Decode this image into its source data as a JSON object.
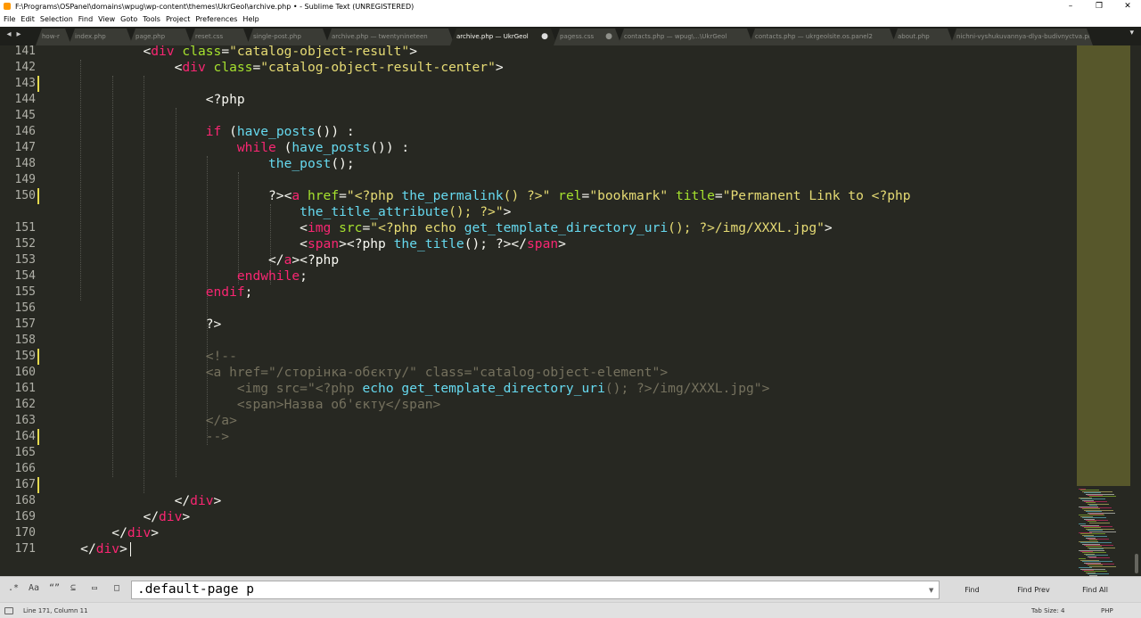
{
  "window": {
    "title": "F:\\Programs\\OSPanel\\domains\\wpug\\wp-content\\themes\\UkrGeol\\archive.php • - Sublime Text (UNREGISTERED)",
    "controls": [
      "–",
      "❐",
      "✕"
    ]
  },
  "menu": [
    "File",
    "Edit",
    "Selection",
    "Find",
    "View",
    "Goto",
    "Tools",
    "Project",
    "Preferences",
    "Help"
  ],
  "tabs": [
    {
      "label": "how-r",
      "active": false,
      "dirty": false
    },
    {
      "label": "index.php",
      "active": false,
      "dirty": false
    },
    {
      "label": "page.php",
      "active": false,
      "dirty": false
    },
    {
      "label": "reset.css",
      "active": false,
      "dirty": false
    },
    {
      "label": "single-post.php",
      "active": false,
      "dirty": false
    },
    {
      "label": "archive.php — twentynineteen",
      "active": false,
      "dirty": false
    },
    {
      "label": "archive.php — UkrGeol",
      "active": true,
      "dirty": true
    },
    {
      "label": "pagess.css",
      "active": false,
      "dirty": true
    },
    {
      "label": "contacts.php — wpug\\...\\UkrGeol",
      "active": false,
      "dirty": false
    },
    {
      "label": "contacts.php — ukrgeolsite.os.panel2",
      "active": false,
      "dirty": false
    },
    {
      "label": "about.php",
      "active": false,
      "dirty": false
    },
    {
      "label": "nichni-vyshukuvannya-dlya-budivnyctva.php",
      "active": false,
      "dirty": false
    }
  ],
  "tab_overflow": "▾",
  "gutter": {
    "line_numbers": [
      "141",
      "142",
      "143",
      "144",
      "145",
      "146",
      "147",
      "148",
      "149",
      "150",
      "",
      "151",
      "152",
      "153",
      "154",
      "155",
      "156",
      "157",
      "158",
      "159",
      "160",
      "161",
      "162",
      "163",
      "164",
      "165",
      "166",
      "167",
      "168",
      "169",
      "170",
      "171"
    ],
    "modified_lines": [
      "143",
      "150",
      "159",
      "164",
      "167"
    ]
  },
  "code_lines": [
    [
      [
        "            ",
        ""
      ],
      [
        "<",
        "t"
      ],
      [
        "div",
        "tag"
      ],
      [
        " class",
        "attr"
      ],
      [
        "=",
        ""
      ],
      [
        "\"catalog-object-result\"",
        "str"
      ],
      [
        ">",
        ""
      ]
    ],
    [
      [
        "                ",
        ""
      ],
      [
        "<",
        ""
      ],
      [
        "div",
        "tag"
      ],
      [
        " class",
        "attr"
      ],
      [
        "=",
        ""
      ],
      [
        "\"catalog-object-result-center\"",
        "str"
      ],
      [
        ">",
        ""
      ]
    ],
    [
      [
        "",
        ""
      ]
    ],
    [
      [
        "                    ",
        ""
      ],
      [
        "<?php",
        ""
      ]
    ],
    [
      [
        "",
        ""
      ]
    ],
    [
      [
        "                    ",
        ""
      ],
      [
        "if",
        "kw"
      ],
      [
        " (",
        ""
      ],
      [
        "have_posts",
        "fn"
      ],
      [
        "()) :",
        ""
      ]
    ],
    [
      [
        "                        ",
        ""
      ],
      [
        "while",
        "kw"
      ],
      [
        " (",
        ""
      ],
      [
        "have_posts",
        "fn"
      ],
      [
        "()) :",
        ""
      ]
    ],
    [
      [
        "                            ",
        ""
      ],
      [
        "the_post",
        "fn"
      ],
      [
        "();",
        ""
      ]
    ],
    [
      [
        "",
        ""
      ]
    ],
    [
      [
        "                            ",
        ""
      ],
      [
        "?><",
        ""
      ],
      [
        "a",
        "tag"
      ],
      [
        " href",
        "attr"
      ],
      [
        "=",
        ""
      ],
      [
        "\"<?php ",
        "str"
      ],
      [
        "the_permalink",
        "fn"
      ],
      [
        "() ?>\"",
        "str"
      ],
      [
        " rel",
        "attr"
      ],
      [
        "=",
        ""
      ],
      [
        "\"bookmark\"",
        "str"
      ],
      [
        " title",
        "attr"
      ],
      [
        "=",
        ""
      ],
      [
        "\"Permanent Link to <?php",
        "str"
      ]
    ],
    [
      [
        "                                ",
        ""
      ],
      [
        "the_title_attribute",
        "fn"
      ],
      [
        "(); ?>\"",
        "str"
      ],
      [
        ">",
        ""
      ]
    ],
    [
      [
        "                                ",
        ""
      ],
      [
        "<",
        ""
      ],
      [
        "img",
        "tag"
      ],
      [
        " src",
        "attr"
      ],
      [
        "=",
        ""
      ],
      [
        "\"<?php echo ",
        "str"
      ],
      [
        "get_template_directory_uri",
        "fn"
      ],
      [
        "(); ?>/img/XXXL.jpg\"",
        "str"
      ],
      [
        ">",
        ""
      ]
    ],
    [
      [
        "                                ",
        ""
      ],
      [
        "<",
        ""
      ],
      [
        "span",
        "tag"
      ],
      [
        "><?php ",
        ""
      ],
      [
        "the_title",
        "fn"
      ],
      [
        "(); ?></",
        ""
      ],
      [
        "span",
        "tag"
      ],
      [
        ">",
        ""
      ]
    ],
    [
      [
        "                            ",
        ""
      ],
      [
        "</",
        ""
      ],
      [
        "a",
        "tag"
      ],
      [
        "><?php",
        ""
      ]
    ],
    [
      [
        "                        ",
        ""
      ],
      [
        "endwhile",
        "kw"
      ],
      [
        ";",
        ""
      ]
    ],
    [
      [
        "                    ",
        ""
      ],
      [
        "endif",
        "kw"
      ],
      [
        ";",
        ""
      ]
    ],
    [
      [
        "",
        ""
      ]
    ],
    [
      [
        "                    ",
        ""
      ],
      [
        "?>",
        ""
      ]
    ],
    [
      [
        "",
        ""
      ]
    ],
    [
      [
        "                    ",
        ""
      ],
      [
        "<!--",
        "cm"
      ]
    ],
    [
      [
        "                    ",
        ""
      ],
      [
        "<a href=\"/сторінка-обєкту/\" class=\"catalog-object-element\">",
        "cm"
      ]
    ],
    [
      [
        "                        ",
        ""
      ],
      [
        "<img src=\"<?php ",
        "cm"
      ],
      [
        "echo",
        "cfn"
      ],
      [
        " ",
        "cm"
      ],
      [
        "get_template_directory_uri",
        "cfn"
      ],
      [
        "(); ?>/img/XXXL.jpg\">",
        "cm"
      ]
    ],
    [
      [
        "                        ",
        ""
      ],
      [
        "<span>Назва об'єкту</span>",
        "cm"
      ]
    ],
    [
      [
        "                    ",
        ""
      ],
      [
        "</a>",
        "cm"
      ]
    ],
    [
      [
        "                    ",
        ""
      ],
      [
        "-->",
        "cm"
      ]
    ],
    [
      [
        "",
        ""
      ]
    ],
    [
      [
        "",
        ""
      ]
    ],
    [
      [
        "",
        ""
      ]
    ],
    [
      [
        "                ",
        ""
      ],
      [
        "</",
        ""
      ],
      [
        "div",
        "tag"
      ],
      [
        ">",
        ""
      ]
    ],
    [
      [
        "            ",
        ""
      ],
      [
        "</",
        ""
      ],
      [
        "div",
        "tag"
      ],
      [
        ">",
        ""
      ]
    ],
    [
      [
        "        ",
        ""
      ],
      [
        "</",
        ""
      ],
      [
        "div",
        "tag"
      ],
      [
        ">",
        ""
      ]
    ],
    [
      [
        "    ",
        ""
      ],
      [
        "</",
        ""
      ],
      [
        "div",
        "tag"
      ],
      [
        ">",
        ""
      ]
    ]
  ],
  "find": {
    "options": [
      ".*",
      "Aa",
      "“”",
      "⊆",
      "▭",
      "□"
    ],
    "query": ".default-page p",
    "buttons": [
      "Find",
      "Find Prev",
      "Find All"
    ]
  },
  "status": {
    "position": "Line 171, Column 11",
    "tab_size": "Tab Size: 4",
    "syntax": "PHP"
  }
}
